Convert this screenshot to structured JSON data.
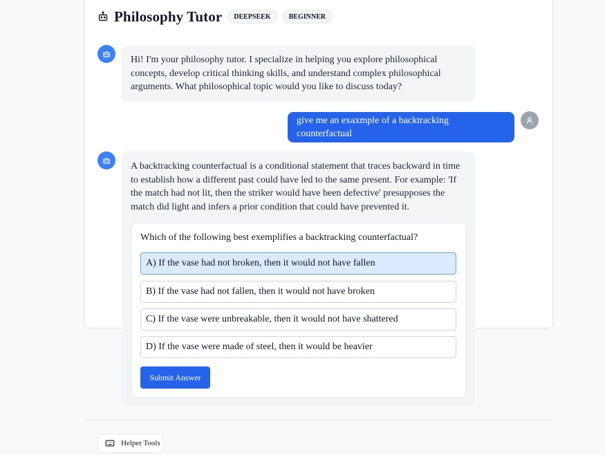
{
  "header": {
    "title": "Philosophy Tutor",
    "badges": [
      "DEEPSEEK",
      "BEGINNER"
    ]
  },
  "messages": [
    {
      "role": "assistant",
      "text": "Hi! I'm your philosophy tutor. I specialize in helping you explore philosophical concepts, develop critical thinking skills, and understand complex philosophical arguments. What philosophical topic would you like to discuss today?"
    },
    {
      "role": "user",
      "text": "give me an exaxmple of a backtracking counterfactual"
    },
    {
      "role": "assistant",
      "text": "A backtracking counterfactual is a conditional statement that traces backward in time to establish how a different past could have led to the same present. For example: 'If the match had not lit, then the striker would have been defective' presupposes the match did light and infers a prior condition that could have prevented it."
    }
  ],
  "quiz": {
    "question": "Which of the following best exemplifies a backtracking counterfactual?",
    "options": [
      "A) If the vase had not broken, then it would not have fallen",
      "B) If the vase had not fallen, then it would not have broken",
      "C) If the vase were unbreakable, then it would not have shattered",
      "D) If the vase were made of steel, then it would be heavier"
    ],
    "selected_option": "A) If the vase had not broken, then it would not have fallen",
    "submit_label": "Submit Answer"
  },
  "footer": {
    "helper_label": "Helper Tools"
  },
  "colors": {
    "accent": "#2563eb",
    "bot_avatar": "#3b82f6",
    "user_avatar": "#9ca3af",
    "selected_option_bg": "#dbeafe"
  },
  "icons": {
    "header": "bot-icon",
    "assistant_avatar": "bot-icon",
    "user_avatar": "user-icon",
    "helper": "keyboard-icon"
  }
}
